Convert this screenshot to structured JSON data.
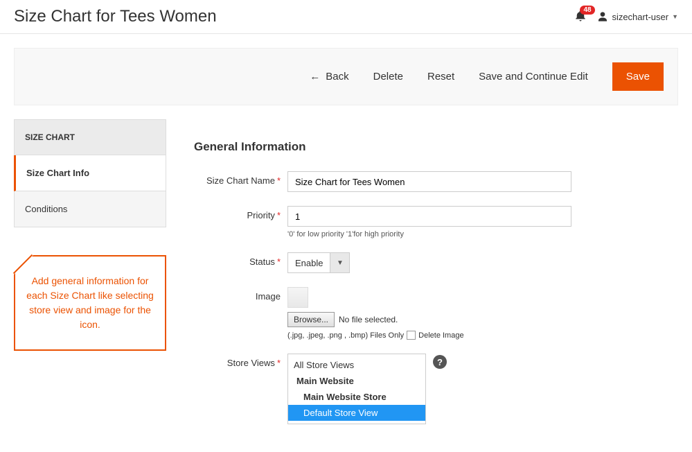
{
  "header": {
    "title": "Size Chart for Tees Women",
    "notif_count": "48",
    "username": "sizechart-user"
  },
  "actions": {
    "back": "Back",
    "delete": "Delete",
    "reset": "Reset",
    "save_continue": "Save and Continue Edit",
    "save": "Save"
  },
  "sidebar": {
    "panel_title": "SIZE CHART",
    "tabs": [
      {
        "label": "Size Chart Info",
        "active": true
      },
      {
        "label": "Conditions",
        "active": false
      }
    ],
    "callout": "Add general information for each Size Chart like selecting store view and image for the icon."
  },
  "form": {
    "section_title": "General Information",
    "name_label": "Size Chart Name",
    "name_value": "Size Chart for Tees Women",
    "priority_label": "Priority",
    "priority_value": "1",
    "priority_helper": "'0' for low priority '1'for high priority",
    "status_label": "Status",
    "status_value": "Enable",
    "image_label": "Image",
    "browse_label": "Browse...",
    "nofile_text": "No file selected.",
    "image_helper": "(.jpg, .jpeg, .png , .bmp) Files Only",
    "delete_image_label": "Delete Image",
    "store_label": "Store Views",
    "store_options": {
      "all": "All Store Views",
      "website": "Main Website",
      "store": "Main Website Store",
      "view": "Default Store View"
    }
  }
}
